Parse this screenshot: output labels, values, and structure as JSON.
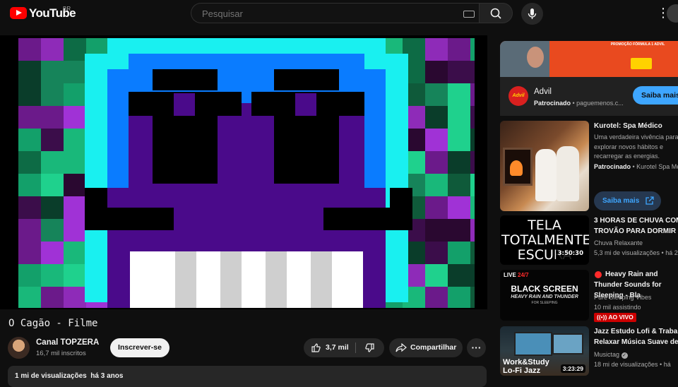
{
  "header": {
    "logo_text": "YouTube",
    "region": "BR",
    "search_placeholder": "Pesquisar"
  },
  "video": {
    "title": "O Cagão - Filme",
    "channel_name": "Canal TOPZERA",
    "subscribers": "16,7 mil inscritos",
    "subscribe_label": "Inscrever-se",
    "likes": "3,7 mil",
    "share_label": "Compartilhar",
    "views": "1 mi de visualizações",
    "age": "há 3 anos"
  },
  "ad": {
    "logo_text": "Advil",
    "name": "Advil",
    "sponsored": "Patrocinado",
    "domain": "paguemenos.c...",
    "cta": "Saiba mais",
    "banner_text": "PROMOÇÃO FÓRMULA 1 ADVIL"
  },
  "recommendations": [
    {
      "title": "Kurotel: Spa Médico",
      "body": "Uma verdadeira vivência para explorar novos hábitos e recarregar as energias.",
      "sponsored": "Patrocinado",
      "channel": "Kurotel Spa Mé",
      "cta": "Saiba mais"
    },
    {
      "title": "3 HORAS DE CHUVA COM TROVÃO PARA DORMIR E",
      "channel": "Chuva Relaxante",
      "stats": "5,3 mi de visualizações",
      "age": "há 2",
      "duration": "3:50:30",
      "thumb_text": "TELA TOTALMENTE ESCURA"
    },
    {
      "title": "Heavy Rain and Thunder Sounds for Sleeping - Bla",
      "channel": "Pure Sleeping Vibes",
      "stats": "10 mil assistindo",
      "live_label": "AO VIVO",
      "thumb_live": "LIVE",
      "thumb_live_hours": "24/7",
      "thumb_line1": "BLACK SCREEN",
      "thumb_line2": "HEAVY RAIN AND THUNDER",
      "thumb_line3": "FOR SLEEPING"
    },
    {
      "title": "Jazz Estudo Lofi & Trabal Relaxar Música Suave de",
      "channel": "Musictag",
      "stats": "18 mi de visualizações",
      "age": "há",
      "duration": "3:23:29",
      "thumb_line1": "Work&Study",
      "thumb_line2": "Lo-Fi Jazz"
    }
  ],
  "colors": {
    "background": "#0f0f0f",
    "accent_blue": "#3ea6ff",
    "youtube_red": "#ff0000",
    "live_red": "#cc0000"
  }
}
